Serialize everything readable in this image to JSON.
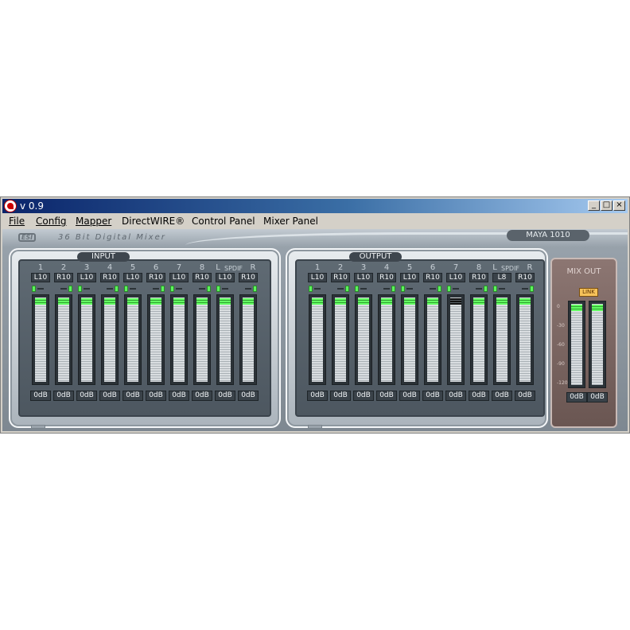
{
  "window": {
    "title": "v 0.9",
    "btn_min": "_",
    "btn_max": "□",
    "btn_close": "×"
  },
  "menu": {
    "items": [
      "File",
      "Config",
      "Mapper",
      "DirectWIRE®",
      "Control Panel",
      "Mixer Panel"
    ]
  },
  "header": {
    "logo": "ESI",
    "brand": "36 Bit Digital Mixer",
    "model": "MAYA 1010"
  },
  "input": {
    "label": "INPUT",
    "spdif": "SPDIF",
    "channels": [
      {
        "num": "1",
        "pan": "L10",
        "level": "0dB"
      },
      {
        "num": "2",
        "pan": "R10",
        "level": "0dB"
      },
      {
        "num": "3",
        "pan": "L10",
        "level": "0dB"
      },
      {
        "num": "4",
        "pan": "R10",
        "level": "0dB"
      },
      {
        "num": "5",
        "pan": "L10",
        "level": "0dB"
      },
      {
        "num": "6",
        "pan": "R10",
        "level": "0dB"
      },
      {
        "num": "7",
        "pan": "L10",
        "level": "0dB"
      },
      {
        "num": "8",
        "pan": "R10",
        "level": "0dB"
      },
      {
        "num": "L",
        "pan": "L10",
        "level": "0dB"
      },
      {
        "num": "R",
        "pan": "R10",
        "level": "0dB"
      }
    ]
  },
  "output": {
    "label": "OUTPUT",
    "spdif": "SPDIF",
    "channels": [
      {
        "num": "1",
        "pan": "L10",
        "level": "0dB"
      },
      {
        "num": "2",
        "pan": "R10",
        "level": "0dB"
      },
      {
        "num": "3",
        "pan": "L10",
        "level": "0dB"
      },
      {
        "num": "4",
        "pan": "R10",
        "level": "0dB"
      },
      {
        "num": "5",
        "pan": "L10",
        "level": "0dB"
      },
      {
        "num": "6",
        "pan": "R10",
        "level": "0dB"
      },
      {
        "num": "7",
        "pan": "L10",
        "level": "0dB"
      },
      {
        "num": "8",
        "pan": "R10",
        "level": "0dB"
      },
      {
        "num": "L",
        "pan": "L8",
        "level": "0dB"
      },
      {
        "num": "R",
        "pan": "R10",
        "level": "0dB"
      }
    ]
  },
  "mixout": {
    "label": "MIX OUT",
    "link": "LINK",
    "scale": [
      "0",
      "-30",
      "-60",
      "-90",
      "-120"
    ],
    "channels": [
      {
        "level": "0dB"
      },
      {
        "level": "0dB"
      }
    ]
  },
  "colors": {
    "led_green": "#5cf35c",
    "panel_dark": "#4d5760",
    "mixout": "#7a6460",
    "link": "#f6c25a"
  }
}
